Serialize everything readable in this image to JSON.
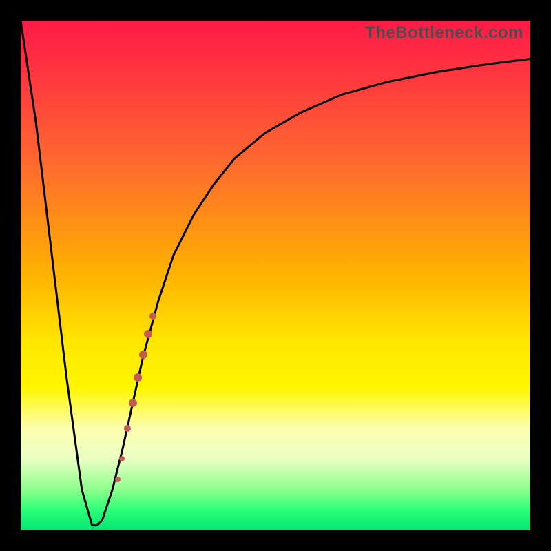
{
  "watermark": "TheBottleneck.com",
  "colors": {
    "frame": "#000000",
    "curve": "#000000",
    "dot": "#c65a57",
    "gradient_top": "#ff1a46",
    "gradient_bottom": "#00e673"
  },
  "chart_data": {
    "type": "line",
    "title": "",
    "xlabel": "",
    "ylabel": "",
    "xlim": [
      0,
      100
    ],
    "ylim": [
      0,
      100
    ],
    "annotations": [],
    "series": [
      {
        "name": "bottleneck-curve",
        "x": [
          0,
          3,
          6,
          9,
          12,
          14,
          15,
          16,
          18,
          20,
          22,
          24,
          27,
          30,
          34,
          38,
          42,
          48,
          55,
          63,
          72,
          82,
          92,
          100
        ],
        "y": [
          100,
          80,
          55,
          30,
          8,
          1,
          1,
          2,
          8,
          16,
          25,
          34,
          45,
          54,
          62,
          68,
          73,
          78,
          82,
          85.5,
          88,
          90,
          91.5,
          92.5
        ]
      }
    ],
    "markers": [
      {
        "x": 19.0,
        "y": 10.0,
        "r": 4
      },
      {
        "x": 19.8,
        "y": 14.0,
        "r": 4
      },
      {
        "x": 21.0,
        "y": 20.0,
        "r": 5
      },
      {
        "x": 22.0,
        "y": 25.0,
        "r": 6
      },
      {
        "x": 23.0,
        "y": 30.0,
        "r": 6
      },
      {
        "x": 24.0,
        "y": 34.5,
        "r": 6
      },
      {
        "x": 25.0,
        "y": 38.5,
        "r": 6
      },
      {
        "x": 26.0,
        "y": 42.0,
        "r": 5
      }
    ]
  }
}
